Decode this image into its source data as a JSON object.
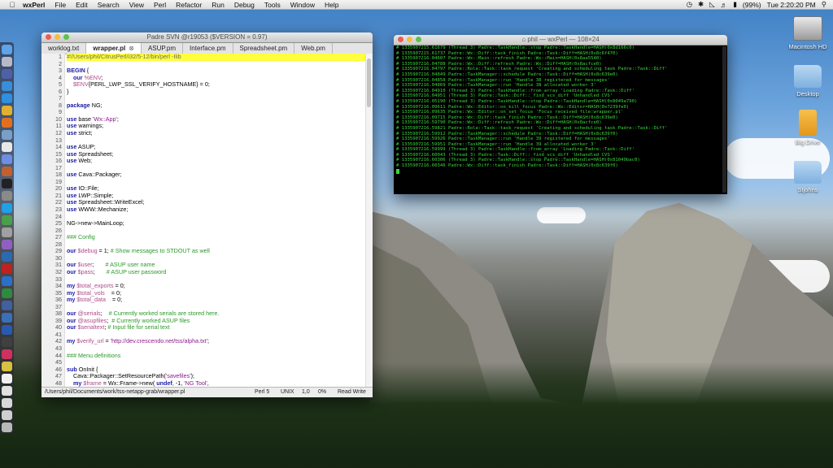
{
  "menubar": {
    "app_name": "wxPerl",
    "menus": [
      "File",
      "Edit",
      "Search",
      "View",
      "Perl",
      "Refactor",
      "Run",
      "Debug",
      "Tools",
      "Window",
      "Help"
    ],
    "battery": "(99%)",
    "clock": "Tue 2:20:20 PM"
  },
  "desktop_icons": [
    "Macintosh HD",
    "Desktop",
    "Big Drive",
    "Stjohns"
  ],
  "editor": {
    "title": "Padre SVN @r19053 ($VERSION = 0.97)",
    "tabs": [
      {
        "label": "worklog.txt",
        "active": false
      },
      {
        "label": "wrapper.pl",
        "active": true
      },
      {
        "label": "ASUP.pm",
        "active": false
      },
      {
        "label": "Interface.pm",
        "active": false
      },
      {
        "label": "Spreadsheet.pm",
        "active": false
      },
      {
        "label": "Web.pm",
        "active": false
      }
    ],
    "lines": [
      {
        "n": "1",
        "text": "#!/Users/phil/CitrusPerl/i32/5-12/bin/perl -Ilib"
      },
      {
        "n": "2",
        "text": ""
      },
      {
        "n": "3",
        "text": "BEGIN {"
      },
      {
        "n": "4",
        "text": "    our %ENV;"
      },
      {
        "n": "5",
        "text": "    $ENV{PERL_LWP_SSL_VERIFY_HOSTNAME} = 0;"
      },
      {
        "n": "6",
        "text": "}"
      },
      {
        "n": "7",
        "text": ""
      },
      {
        "n": "8",
        "text": "package NG;"
      },
      {
        "n": "9",
        "text": ""
      },
      {
        "n": "10",
        "text": "use base 'Wx::App';"
      },
      {
        "n": "11",
        "text": "use warnings;"
      },
      {
        "n": "12",
        "text": "use strict;"
      },
      {
        "n": "13",
        "text": ""
      },
      {
        "n": "14",
        "text": "use ASUP;"
      },
      {
        "n": "15",
        "text": "use Spreadsheet;"
      },
      {
        "n": "16",
        "text": "use Web;"
      },
      {
        "n": "17",
        "text": ""
      },
      {
        "n": "18",
        "text": "use Cava::Packager;"
      },
      {
        "n": "19",
        "text": ""
      },
      {
        "n": "20",
        "text": "use IO::File;"
      },
      {
        "n": "21",
        "text": "use LWP::Simple;"
      },
      {
        "n": "22",
        "text": "use Spreadsheet::WriteExcel;"
      },
      {
        "n": "23",
        "text": "use WWW::Mechanize;"
      },
      {
        "n": "24",
        "text": ""
      },
      {
        "n": "25",
        "text": "NG->new->MainLoop;"
      },
      {
        "n": "26",
        "text": ""
      },
      {
        "n": "27",
        "text": "### Config"
      },
      {
        "n": "28",
        "text": ""
      },
      {
        "n": "29",
        "text": "our $debug = 1; # Show messages to STDOUT as well"
      },
      {
        "n": "30",
        "text": ""
      },
      {
        "n": "31",
        "text": "our $user;       # ASUP user name"
      },
      {
        "n": "32",
        "text": "our $pass;       # ASUP user password"
      },
      {
        "n": "33",
        "text": ""
      },
      {
        "n": "34",
        "text": "my $total_exports = 0;"
      },
      {
        "n": "35",
        "text": "my $total_vols    = 0;"
      },
      {
        "n": "36",
        "text": "my $total_data    = 0;"
      },
      {
        "n": "37",
        "text": ""
      },
      {
        "n": "38",
        "text": "our @serials;    # Currently worked serials are stored here."
      },
      {
        "n": "39",
        "text": "our @asupfiles;  # Currently worked ASUP files"
      },
      {
        "n": "40",
        "text": "our $serialtext; # Input file for serial text"
      },
      {
        "n": "41",
        "text": ""
      },
      {
        "n": "42",
        "text": "my $verify_url = 'http://dev.crescendo.net/tss/alpha.txt';"
      },
      {
        "n": "43",
        "text": ""
      },
      {
        "n": "44",
        "text": "### Menu definitions"
      },
      {
        "n": "45",
        "text": ""
      },
      {
        "n": "46",
        "text": "sub OnInit {"
      },
      {
        "n": "47",
        "text": "    Cava::Packager::SetResourcePath('savefiles');"
      },
      {
        "n": "48",
        "text": "    my $frame = Wx::Frame->new( undef, -1, 'NG Tool',"
      }
    ],
    "status": {
      "path": "/Users/phil/Documents/work/tss-netapp-grab/wrapper.pl",
      "language": "Perl 5",
      "eol": "UNIX",
      "position": "1,0",
      "percent": "0%",
      "mode": "Read Write"
    }
  },
  "terminal": {
    "title": "phil — wxPerl — 108×24",
    "lines": [
      "# 1335907215.61679 (Thread 3) Padre::TaskHandle::stop Padre::TaskHandle=HASH(0x8d166c0)",
      "# 1335907215.61737 Padre::Wx::Diff::task_finish Padre::Task::Diff=HASH(0x8c6f470)",
      "# 1335907216.04607 Padre::Wx::Main::refresh Padre::Wx::Main=HASH(0x8aa5540)",
      "# 1335907216.04788 Padre::Wx::Diff::refresh Padre::Wx::Diff=HASH(0x8acfce0)",
      "# 1335907216.04797 Padre::Role::Task::task_request 'Creating and scheduling task Padre::Task::Diff'",
      "# 1335907216.04849 Padre::TaskManager::schedule Padre::Task::Diff=HASH(0x8c639e0)",
      "# 1335907216.04858 Padre::TaskManager::run 'Handle 38 registered for messages'",
      "# 1335907216.04869 Padre::TaskManager::run 'Handle 38 allocated worker 3'",
      "# 1335907216.04910 (Thread 3) Padre::TaskHandle::from_array 'Loading Padre::Task::Diff'",
      "# 1335907216.04951 (Thread 3) Padre::Task::Diff::_find_vcs_diff 'Unhandled CVS'",
      "# 1335907216.05190 (Thread 3) Padre::TaskHandle::stop Padre::TaskHandle=HASH(0x8049a790)",
      "# 1335907216.09611 Padre::Wx::Editor::on_kill_focus Padre::Wx::Editor=HASH(0x7239fe0)",
      "# 1335907216.09635 Padre::Wx::Editor::on_set_focus 'Focus received file:wrapper.pl'",
      "# 1335907216.09715 Padre::Wx::Diff::task_finish Padre::Task::Diff=HASH(0x8c639e0)",
      "# 1335907216.59790 Padre::Wx::Diff::refresh Padre::Wx::Diff=HASH(0x8acfce0)",
      "# 1335907216.59821 Padre::Role::Task::task_request 'Creating and scheduling task Padre::Task::Diff'",
      "# 1335907216.59912 Padre::TaskManager::schedule Padre::Task::Diff=HASH(0x8c639f0)",
      "# 1335907216.59926 Padre::TaskManager::run 'Handle 39 registered for messages'",
      "# 1335907216.59951 Padre::TaskManager::run 'Handle 39 allocated worker 3'",
      "# 1335907216.59999 (Thread 3) Padre::TaskHandle::from_array 'Loading Padre::Task::Diff'",
      "# 1335907216.60043 (Thread 3) Padre::Task::Diff::_find_vcs_diff 'Unhandled CVS'",
      "# 1335907216.60306 (Thread 3) Padre::TaskHandle::stop Padre::TaskHandle=HASH(0x81049bac0)",
      "# 1335907216.60346 Padre::Wx::Diff::task_finish Padre::Task::Diff=HASH(0x8c639f0)"
    ]
  },
  "colors": {
    "keyword": "#1a1aa6",
    "comment": "#2a9a2a",
    "variable": "#b04a8a",
    "string": "#8a1a8a",
    "shebang_bg": "#ffff3c",
    "terminal_fg": "#3cd63c"
  }
}
